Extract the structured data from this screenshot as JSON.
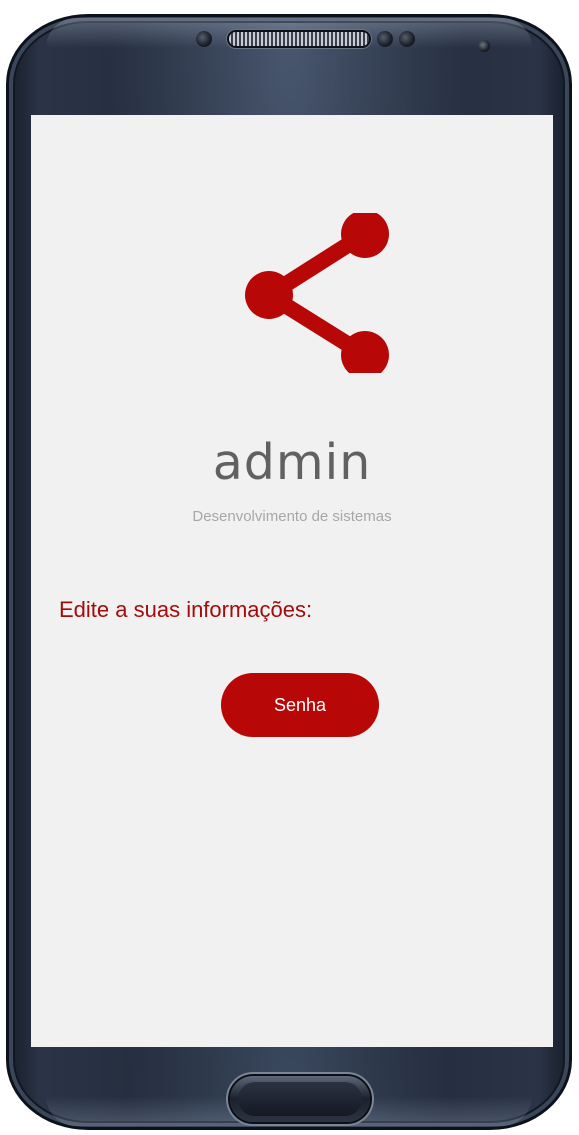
{
  "profile": {
    "icon": "share-icon",
    "name": "admin",
    "subtitle": "Desenvolvimento de sistemas"
  },
  "section": {
    "heading": "Edite a suas informações:"
  },
  "actions": {
    "password_label": "Senha"
  },
  "colors": {
    "accent": "#b80707",
    "heading_text": "#a20c0c",
    "screen_background": "#f1f1f1",
    "device_frame": "#1e2636"
  }
}
